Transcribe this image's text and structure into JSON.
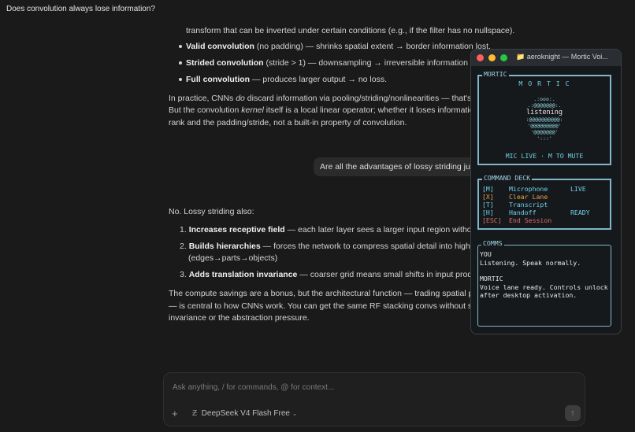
{
  "chat": {
    "title": "Does convolution always lose information?",
    "line_top": "transform that can be inverted under certain conditions (e.g., if the filter has no nullspace).",
    "bullets": [
      {
        "bold": "Valid convolution",
        "rest": " (no padding) — shrinks spatial extent → border information lost."
      },
      {
        "bold": "Strided convolution",
        "rest": " (stride > 1) — downsampling → irreversible information loss ("
      },
      {
        "bold": "Full convolution",
        "rest": " — produces larger output → no loss."
      }
    ],
    "para1_a": "In practice, CNNs ",
    "para1_em": "do",
    "para1_b": " discard information via pooling/striding/nonlinearities — that's th",
    "para1_line2_a": "But the convolution ",
    "para1_line2_em": "kernel",
    "para1_line2_b": " itself is a local linear operator; whether it loses information",
    "para1_line3": "rank and the padding/stride, not a built-in property of convolution.",
    "user_message": "Are all the advantages of lossy striding just",
    "answer_intro": "No. Lossy striding also:",
    "numbered": [
      {
        "n": "1.",
        "bold": "Increases receptive field",
        "rest": " — each later layer sees a larger input region without lar"
      },
      {
        "n": "2.",
        "bold": "Builds hierarchies",
        "rest": " — forces the network to compress spatial detail into higher-le",
        "line2": "(edges→parts→objects)"
      },
      {
        "n": "3.",
        "bold": "Adds translation invariance",
        "rest": " — coarser grid means small shifts in input produce s"
      }
    ],
    "closing_1": "The compute savings are a bonus, but the architectural function — trading spatial pred",
    "closing_2": "— is central to how CNNs work. You can get the same RF stacking convs without strid",
    "closing_3": "invariance or the abstraction pressure.",
    "input_placeholder": "Ask anything, / for commands, @ for context...",
    "model_label": "DeepSeek V4 Flash Free"
  },
  "terminal": {
    "title": "aeroknight — Mortic Voi...",
    "mortic_label": "MORTIC",
    "mortic_banner": "M O R T I C",
    "orb_lines": [
      ".:ooo:.",
      ".:@@@@@@@:.",
      "listening",
      ":@@@@@@@@@@:",
      "'@@@@@@@@@'",
      "'@@@@@@@'",
      "':::'"
    ],
    "mic_status": "MIC LIVE · M TO MUTE",
    "deck_label": "COMMAND DECK",
    "commands": [
      {
        "key": "[M]",
        "name": "Microphone",
        "state": "LIVE",
        "tone": "cyan"
      },
      {
        "key": "[X]",
        "name": "Clear Lane",
        "state": "",
        "tone": "amber"
      },
      {
        "key": "[T]",
        "name": "Transcript",
        "state": "",
        "tone": "cyan"
      },
      {
        "key": "[H]",
        "name": "Handoff",
        "state": "READY",
        "tone": "cyan"
      },
      {
        "key": "[ESC]",
        "name": "End Session",
        "state": "",
        "tone": "red"
      }
    ],
    "comms_label": "COMMS",
    "comms": [
      {
        "who": "YOU",
        "text": "Listening. Speak normally."
      },
      {
        "who": "MORTIC",
        "text": "Voice lane ready. Controls unlock after desktop activation."
      }
    ]
  },
  "colors": {
    "accent": "#6fd0e8",
    "amber": "#e0a14a",
    "red": "#e06a6a"
  }
}
